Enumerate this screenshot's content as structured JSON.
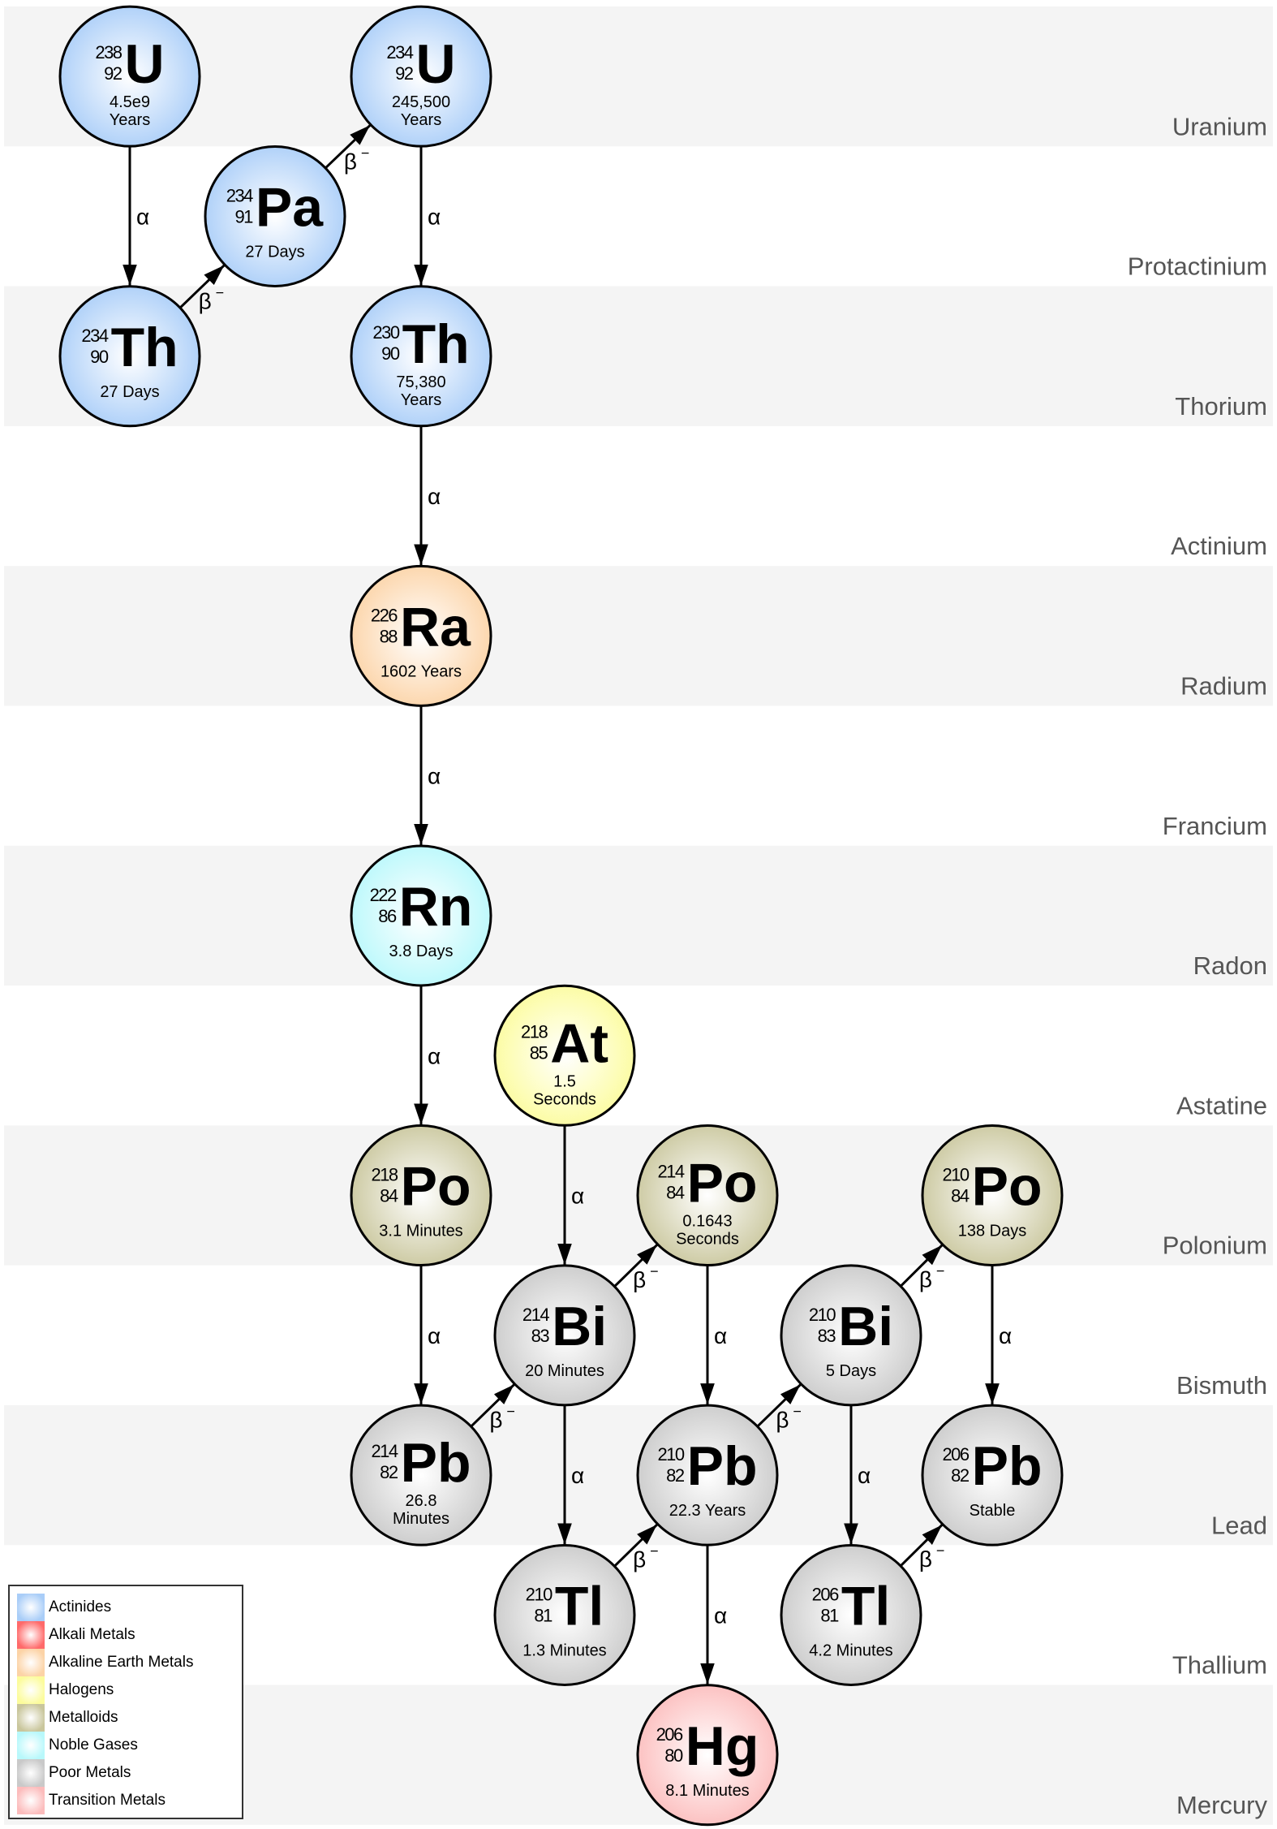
{
  "rows": [
    {
      "element": "Uranium",
      "shaded": true
    },
    {
      "element": "Protactinium",
      "shaded": false
    },
    {
      "element": "Thorium",
      "shaded": true
    },
    {
      "element": "Actinium",
      "shaded": false
    },
    {
      "element": "Radium",
      "shaded": true
    },
    {
      "element": "Francium",
      "shaded": false
    },
    {
      "element": "Radon",
      "shaded": true
    },
    {
      "element": "Astatine",
      "shaded": false
    },
    {
      "element": "Polonium",
      "shaded": true
    },
    {
      "element": "Bismuth",
      "shaded": false
    },
    {
      "element": "Lead",
      "shaded": true
    },
    {
      "element": "Thallium",
      "shaded": false
    },
    {
      "element": "Mercury",
      "shaded": true
    }
  ],
  "categories": {
    "actinides": {
      "label": "Actinides",
      "color": "#a9cdf8"
    },
    "alkali": {
      "label": "Alkali Metals",
      "color": "#ff6a6a"
    },
    "alkaline_earth": {
      "label": "Alkaline Earth Metals",
      "color": "#fcd3a6"
    },
    "halogens": {
      "label": "Halogens",
      "color": "#fcfc9c"
    },
    "metalloids": {
      "label": "Metalloids",
      "color": "#c9c69c"
    },
    "noble_gases": {
      "label": "Noble Gases",
      "color": "#b8f8fb"
    },
    "poor_metals": {
      "label": "Poor Metals",
      "color": "#c9c9c9"
    },
    "transition": {
      "label": "Transition Metals",
      "color": "#fcbcbc"
    }
  },
  "legend": [
    "actinides",
    "alkali",
    "alkaline_earth",
    "halogens",
    "metalloids",
    "noble_gases",
    "poor_metals",
    "transition"
  ],
  "nodes": [
    {
      "id": "U238",
      "symbol": "U",
      "mass": "238",
      "atomic": "92",
      "half_life": [
        "4.5e9",
        "Years"
      ],
      "category": "actinides",
      "row": 0,
      "col": 0
    },
    {
      "id": "U234",
      "symbol": "U",
      "mass": "234",
      "atomic": "92",
      "half_life": [
        "245,500",
        "Years"
      ],
      "category": "actinides",
      "row": 0,
      "col": 2
    },
    {
      "id": "Pa234",
      "symbol": "Pa",
      "mass": "234",
      "atomic": "91",
      "half_life": [
        "27 Days"
      ],
      "category": "actinides",
      "row": 1,
      "col": 1
    },
    {
      "id": "Th234",
      "symbol": "Th",
      "mass": "234",
      "atomic": "90",
      "half_life": [
        "27 Days"
      ],
      "category": "actinides",
      "row": 2,
      "col": 0
    },
    {
      "id": "Th230",
      "symbol": "Th",
      "mass": "230",
      "atomic": "90",
      "half_life": [
        "75,380",
        "Years"
      ],
      "category": "actinides",
      "row": 2,
      "col": 2
    },
    {
      "id": "Ra226",
      "symbol": "Ra",
      "mass": "226",
      "atomic": "88",
      "half_life": [
        "1602 Years"
      ],
      "category": "alkaline_earth",
      "row": 4,
      "col": 2
    },
    {
      "id": "Rn222",
      "symbol": "Rn",
      "mass": "222",
      "atomic": "86",
      "half_life": [
        "3.8 Days"
      ],
      "category": "noble_gases",
      "row": 6,
      "col": 2
    },
    {
      "id": "At218",
      "symbol": "At",
      "mass": "218",
      "atomic": "85",
      "half_life": [
        "1.5",
        "Seconds"
      ],
      "category": "halogens",
      "row": 7,
      "col": 3
    },
    {
      "id": "Po218",
      "symbol": "Po",
      "mass": "218",
      "atomic": "84",
      "half_life": [
        "3.1 Minutes"
      ],
      "category": "metalloids",
      "row": 8,
      "col": 2
    },
    {
      "id": "Po214",
      "symbol": "Po",
      "mass": "214",
      "atomic": "84",
      "half_life": [
        "0.1643",
        "Seconds"
      ],
      "category": "metalloids",
      "row": 8,
      "col": 4
    },
    {
      "id": "Po210",
      "symbol": "Po",
      "mass": "210",
      "atomic": "84",
      "half_life": [
        "138 Days"
      ],
      "category": "metalloids",
      "row": 8,
      "col": 6
    },
    {
      "id": "Bi214",
      "symbol": "Bi",
      "mass": "214",
      "atomic": "83",
      "half_life": [
        "20 Minutes"
      ],
      "category": "poor_metals",
      "row": 9,
      "col": 3
    },
    {
      "id": "Bi210",
      "symbol": "Bi",
      "mass": "210",
      "atomic": "83",
      "half_life": [
        "5 Days"
      ],
      "category": "poor_metals",
      "row": 9,
      "col": 5
    },
    {
      "id": "Pb214",
      "symbol": "Pb",
      "mass": "214",
      "atomic": "82",
      "half_life": [
        "26.8",
        "Minutes"
      ],
      "category": "poor_metals",
      "row": 10,
      "col": 2
    },
    {
      "id": "Pb210",
      "symbol": "Pb",
      "mass": "210",
      "atomic": "82",
      "half_life": [
        "22.3 Years"
      ],
      "category": "poor_metals",
      "row": 10,
      "col": 4
    },
    {
      "id": "Pb206",
      "symbol": "Pb",
      "mass": "206",
      "atomic": "82",
      "half_life": [
        "Stable"
      ],
      "category": "poor_metals",
      "row": 10,
      "col": 6
    },
    {
      "id": "Tl210",
      "symbol": "Tl",
      "mass": "210",
      "atomic": "81",
      "half_life": [
        "1.3 Minutes"
      ],
      "category": "poor_metals",
      "row": 11,
      "col": 3
    },
    {
      "id": "Tl206",
      "symbol": "Tl",
      "mass": "206",
      "atomic": "81",
      "half_life": [
        "4.2 Minutes"
      ],
      "category": "poor_metals",
      "row": 11,
      "col": 5
    },
    {
      "id": "Hg206",
      "symbol": "Hg",
      "mass": "206",
      "atomic": "80",
      "half_life": [
        "8.1 Minutes"
      ],
      "category": "transition",
      "row": 12,
      "col": 4
    }
  ],
  "decays": [
    {
      "from": "U238",
      "to": "Th234",
      "mode": "alpha"
    },
    {
      "from": "Th234",
      "to": "Pa234",
      "mode": "beta"
    },
    {
      "from": "Pa234",
      "to": "U234",
      "mode": "beta"
    },
    {
      "from": "U234",
      "to": "Th230",
      "mode": "alpha"
    },
    {
      "from": "Th230",
      "to": "Ra226",
      "mode": "alpha"
    },
    {
      "from": "Ra226",
      "to": "Rn222",
      "mode": "alpha"
    },
    {
      "from": "Rn222",
      "to": "Po218",
      "mode": "alpha"
    },
    {
      "from": "Po218",
      "to": "Pb214",
      "mode": "alpha"
    },
    {
      "from": "At218",
      "to": "Bi214",
      "mode": "alpha"
    },
    {
      "from": "Pb214",
      "to": "Bi214",
      "mode": "beta"
    },
    {
      "from": "Bi214",
      "to": "Po214",
      "mode": "beta"
    },
    {
      "from": "Bi214",
      "to": "Tl210",
      "mode": "alpha"
    },
    {
      "from": "Po214",
      "to": "Pb210",
      "mode": "alpha"
    },
    {
      "from": "Tl210",
      "to": "Pb210",
      "mode": "beta"
    },
    {
      "from": "Pb210",
      "to": "Bi210",
      "mode": "beta"
    },
    {
      "from": "Pb210",
      "to": "Hg206",
      "mode": "alpha"
    },
    {
      "from": "Bi210",
      "to": "Po210",
      "mode": "beta"
    },
    {
      "from": "Bi210",
      "to": "Tl206",
      "mode": "alpha"
    },
    {
      "from": "Po210",
      "to": "Pb206",
      "mode": "alpha"
    },
    {
      "from": "Tl206",
      "to": "Pb206",
      "mode": "beta"
    }
  ],
  "decay_labels": {
    "alpha": "α",
    "beta": "β",
    "beta_sup": "−"
  }
}
